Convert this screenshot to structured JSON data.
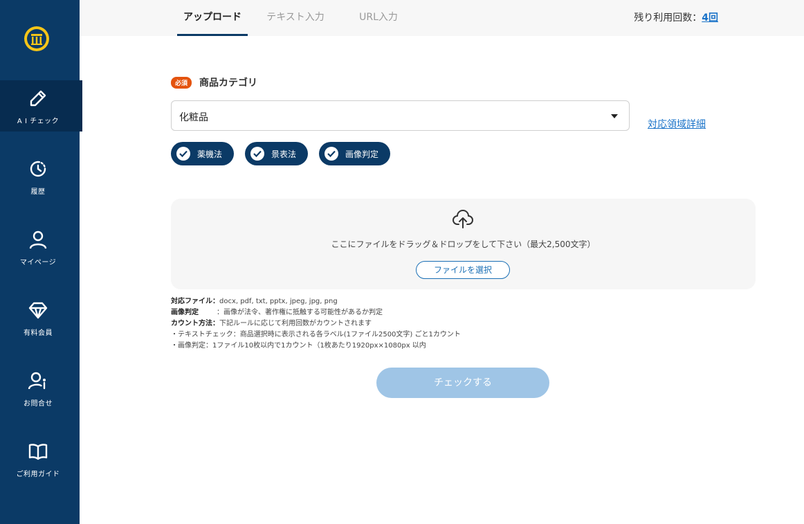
{
  "sidebar": {
    "items": [
      {
        "label": "A I チェック",
        "icon": "pencil-icon",
        "active": true
      },
      {
        "label": "履歴",
        "icon": "history-icon"
      },
      {
        "label": "マイページ",
        "icon": "user-icon"
      },
      {
        "label": "有料会員",
        "icon": "diamond-icon"
      },
      {
        "label": "お問合せ",
        "icon": "contact-user-icon"
      },
      {
        "label": "ご利用ガイド",
        "icon": "book-icon"
      }
    ]
  },
  "tabs": [
    {
      "label": "アップロード",
      "active": true
    },
    {
      "label": "テキスト入力"
    },
    {
      "label": "URL入力"
    }
  ],
  "remaining": {
    "label": "残り利用回数：",
    "value": "4回"
  },
  "category": {
    "required_badge": "必須",
    "label": "商品カテゴリ",
    "selected": "化粧品",
    "detail_link": "対応領域詳細"
  },
  "chips": [
    {
      "label": "薬機法",
      "checked": true
    },
    {
      "label": "景表法",
      "checked": true
    },
    {
      "label": "画像判定",
      "checked": true
    }
  ],
  "dropzone": {
    "text": "ここにファイルをドラッグ＆ドロップをして下さい（最大2,500文字）",
    "button": "ファイルを選択"
  },
  "notes": {
    "formats_key": "対応ファイル：",
    "formats_val": "docx, pdf, txt, pptx, jpeg, jpg, png",
    "image_key": "画像判定",
    "image_val": "：画像が法令、著作権に抵触する可能性があるか判定",
    "count_key": "カウント方法：",
    "count_val": "下記ルールに応じて利用回数がカウントされます",
    "bullet1": "・テキストチェック：商品選択時に表示される各ラベル(1ファイル2500文字) ごと1カウント",
    "bullet2": "・画像判定：1ファイル10枚以内で1カウント（1枚あたり1920px×1080px 以内"
  },
  "check_button": "チェックする",
  "colors": {
    "sidebar": "#0b3a66",
    "accent": "#1a73c9",
    "badge": "#e4530e",
    "button_disabled": "#9fc5e6"
  }
}
